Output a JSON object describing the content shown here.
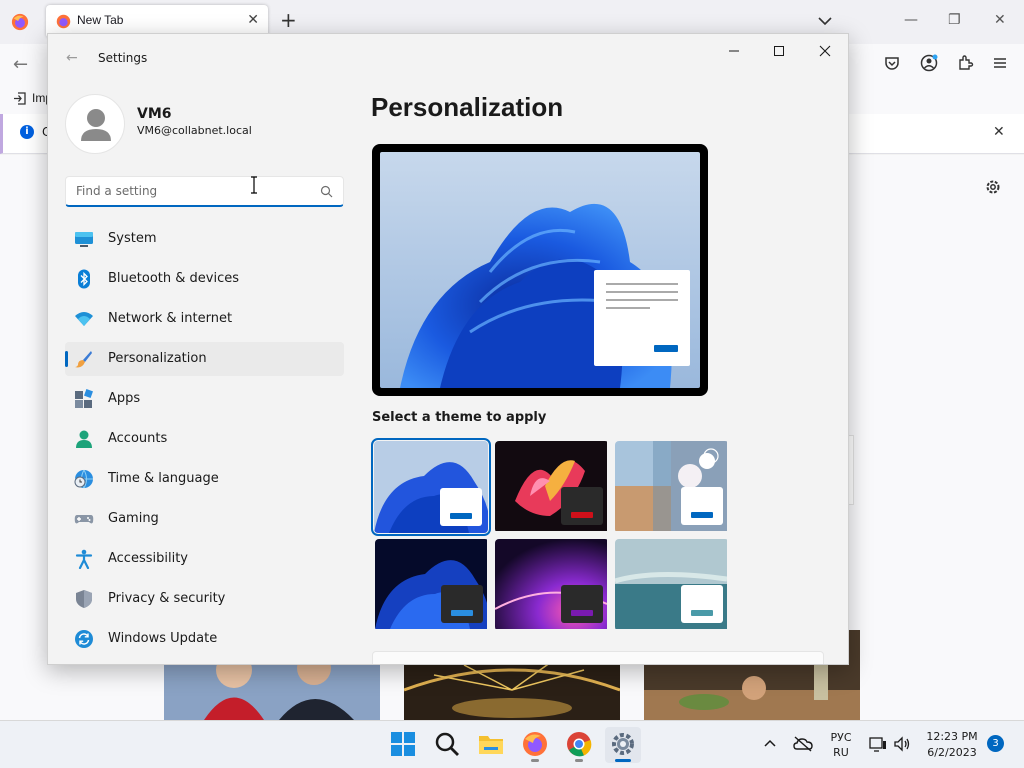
{
  "browser": {
    "tab_title": "New Tab",
    "bookmark_text": "Imp",
    "notice_text": "C"
  },
  "settings": {
    "window_title": "Settings",
    "user": {
      "name": "VM6",
      "email": "VM6@collabnet.local"
    },
    "search": {
      "placeholder": "Find a setting"
    },
    "nav": [
      {
        "label": "System",
        "icon": "system-icon"
      },
      {
        "label": "Bluetooth & devices",
        "icon": "bluetooth-icon"
      },
      {
        "label": "Network & internet",
        "icon": "wifi-icon"
      },
      {
        "label": "Personalization",
        "icon": "brush-icon",
        "active": true
      },
      {
        "label": "Apps",
        "icon": "apps-icon"
      },
      {
        "label": "Accounts",
        "icon": "accounts-icon"
      },
      {
        "label": "Time & language",
        "icon": "clock-globe-icon"
      },
      {
        "label": "Gaming",
        "icon": "gamepad-icon"
      },
      {
        "label": "Accessibility",
        "icon": "accessibility-icon"
      },
      {
        "label": "Privacy & security",
        "icon": "shield-icon"
      },
      {
        "label": "Windows Update",
        "icon": "update-icon"
      }
    ],
    "page": {
      "heading": "Personalization",
      "themes_label": "Select a theme to apply"
    }
  },
  "taskbar": {
    "lang_top": "РУС",
    "lang_bottom": "RU",
    "time": "12:23 PM",
    "date": "6/2/2023",
    "notification_count": "3"
  },
  "colors": {
    "accent": "#0067c0",
    "window_bg": "#f3f3f3"
  }
}
